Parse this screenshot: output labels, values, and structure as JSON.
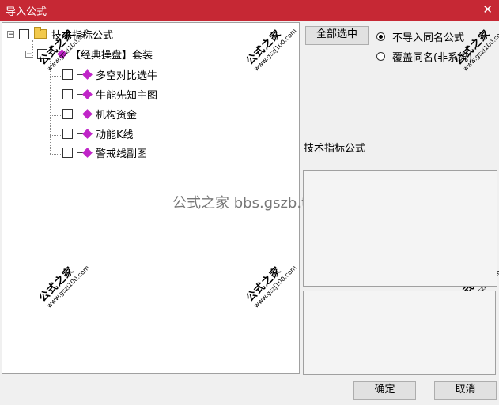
{
  "window": {
    "title": "导入公式",
    "close_glyph": "✕"
  },
  "tree": {
    "root_label": "技术指标公式",
    "group_label": "【经典操盘】套装",
    "items": [
      {
        "label": "多空对比选牛"
      },
      {
        "label": "牛能先知主图"
      },
      {
        "label": "机构资金"
      },
      {
        "label": "动能K线"
      },
      {
        "label": "警戒线副图"
      }
    ]
  },
  "toolbar": {
    "select_all_label": "全部选中"
  },
  "options": {
    "no_import_same_name": "不导入同名公式",
    "overwrite_same_name": "覆盖同名(非系统)",
    "selected": "no_import_same_name"
  },
  "info": {
    "formula_type": "技术指标公式"
  },
  "watermark": {
    "brand": "公式之家",
    "url": "www.gszj100.com",
    "center_text": "公式之家 bbs.gszb.top"
  },
  "footer": {
    "ok_label": "确定",
    "cancel_label": "取消"
  },
  "colors": {
    "titlebar": "#c62834",
    "gem": "#c025c8",
    "folder": "#f2c94c"
  },
  "icons": {
    "root": "folder-icon",
    "leaf": "formula-diamond-icon"
  }
}
